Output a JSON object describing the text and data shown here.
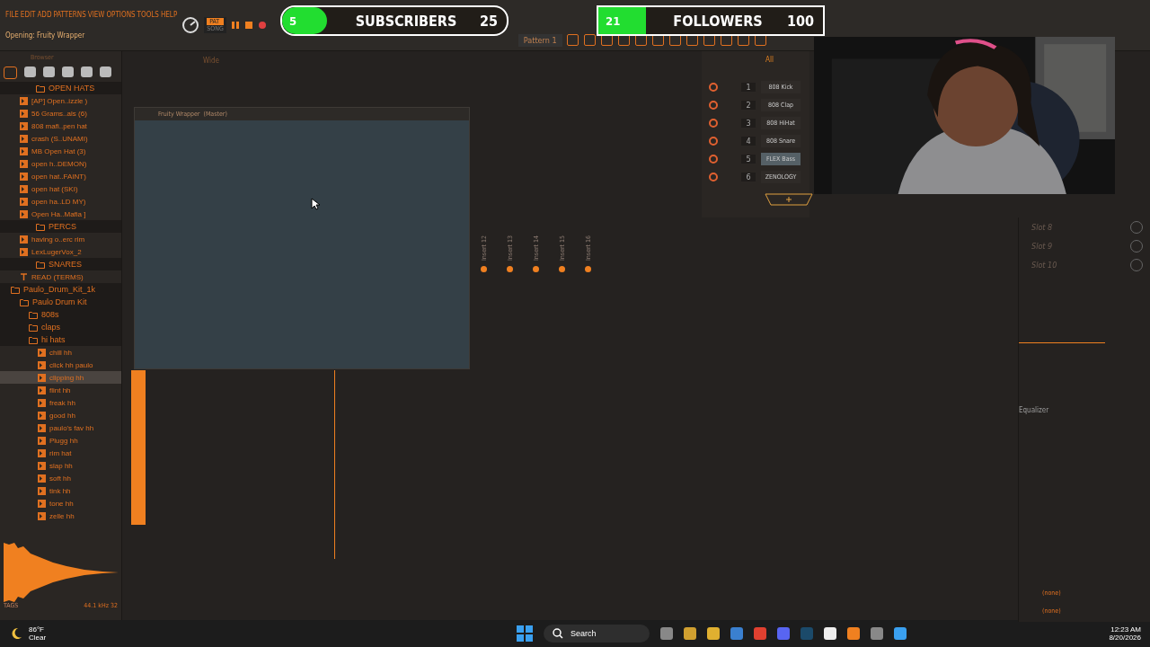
{
  "menu": [
    "FILE",
    "EDIT",
    "ADD",
    "PATTERNS",
    "VIEW",
    "OPTIONS",
    "TOOLS",
    "HELP"
  ],
  "hint": "Opening: Fruity Wrapper",
  "transport": {
    "mode": "PAT",
    "alt_mode": "SONG",
    "pattern": "Pattern 1"
  },
  "counters": [
    {
      "current": "5",
      "label": "SUBSCRIBERS",
      "goal": "25",
      "level": 0.2,
      "kind": "pill"
    },
    {
      "current": "21",
      "label": "FOLLOWERS",
      "goal": "100",
      "level": 0.21,
      "kind": "box"
    }
  ],
  "browser": {
    "title": "Browser",
    "tree": [
      {
        "label": "OPEN HATS",
        "kind": "folder",
        "selected": false,
        "children": [
          {
            "label": "[AP] Open..izzle )",
            "kind": "file",
            "selected": false
          },
          {
            "label": "56 Grams..als (6)",
            "kind": "file",
            "selected": false
          },
          {
            "label": "808 mafi..pen hat",
            "kind": "file",
            "selected": false
          },
          {
            "label": "crash (S..UNAMI)",
            "kind": "file",
            "selected": false
          },
          {
            "label": "MB Open Hat (3)",
            "kind": "file",
            "selected": false
          },
          {
            "label": "open h..DEMON)",
            "kind": "file",
            "selected": false
          },
          {
            "label": "open hat..FAINT)",
            "kind": "file",
            "selected": false
          },
          {
            "label": "open hat (SKI)",
            "kind": "file",
            "selected": false
          },
          {
            "label": "open ha..LD MY)",
            "kind": "file",
            "selected": false
          },
          {
            "label": "Open Ha..Mafia ]",
            "kind": "file",
            "selected": false
          }
        ]
      },
      {
        "label": "PERCS",
        "kind": "folder",
        "selected": false,
        "children": [
          {
            "label": "having o..erc rim",
            "kind": "file",
            "selected": false
          },
          {
            "label": "LexLugerVox_2",
            "kind": "file",
            "selected": false
          }
        ]
      },
      {
        "label": "SNARES",
        "kind": "folder",
        "selected": false,
        "children": [
          {
            "label": "READ (TERMS)",
            "kind": "text",
            "selected": false
          }
        ]
      },
      {
        "label": "Paulo_Drum_Kit_1k",
        "kind": "folder",
        "selected": false,
        "children": [
          {
            "label": "Paulo Drum Kit",
            "kind": "folder",
            "selected": false,
            "children": [
              {
                "label": "808s",
                "kind": "folder",
                "selected": false
              },
              {
                "label": "claps",
                "kind": "folder",
                "selected": false
              },
              {
                "label": "hi hats",
                "kind": "folder",
                "selected": false,
                "children": [
                  {
                    "label": "chill hh",
                    "kind": "file",
                    "selected": false
                  },
                  {
                    "label": "click hh paulo",
                    "kind": "file",
                    "selected": false
                  },
                  {
                    "label": "clipping hh",
                    "kind": "file",
                    "selected": true
                  },
                  {
                    "label": "flint hh",
                    "kind": "file",
                    "selected": false
                  },
                  {
                    "label": "freak hh",
                    "kind": "file",
                    "selected": false
                  },
                  {
                    "label": "good hh",
                    "kind": "file",
                    "selected": false
                  },
                  {
                    "label": "paulo's fav hh",
                    "kind": "file",
                    "selected": false
                  },
                  {
                    "label": "Plugg hh",
                    "kind": "file",
                    "selected": false
                  },
                  {
                    "label": "rim hat",
                    "kind": "file",
                    "selected": false
                  },
                  {
                    "label": "slap hh",
                    "kind": "file",
                    "selected": false
                  },
                  {
                    "label": "soft hh",
                    "kind": "file",
                    "selected": false
                  },
                  {
                    "label": "tink hh",
                    "kind": "file",
                    "selected": false
                  },
                  {
                    "label": "tone hh",
                    "kind": "file",
                    "selected": false
                  },
                  {
                    "label": "zelle hh",
                    "kind": "file",
                    "selected": false
                  }
                ]
              }
            ]
          }
        ]
      }
    ],
    "sample_info": "44.1 kHz 32",
    "tags": "TAGS"
  },
  "playlist_toolbar": "Wide",
  "wrapper": {
    "title": "Fruity Wrapper",
    "subtitle": "(Master)"
  },
  "mixer_inserts": [
    "Insert 12",
    "Insert 13",
    "Insert 14",
    "Insert 15",
    "Insert 16"
  ],
  "channel_rack": {
    "filter": "All",
    "channels": [
      {
        "number": "1",
        "name": "808 Kick",
        "selected": false
      },
      {
        "number": "2",
        "name": "808 Clap",
        "selected": false
      },
      {
        "number": "3",
        "name": "808 HiHat",
        "selected": false
      },
      {
        "number": "4",
        "name": "808 Snare",
        "selected": false
      },
      {
        "number": "5",
        "name": "FLEX Bass",
        "selected": true
      },
      {
        "number": "6",
        "name": "ZENOLOGY",
        "selected": false
      }
    ]
  },
  "webcam": {
    "kind": "picture"
  },
  "mixer_slots": [
    "Slot 8",
    "Slot 9",
    "Slot 10"
  ],
  "equalizer": "Equalizer",
  "routes": [
    "(none)",
    "(none)"
  ],
  "taskbar": {
    "temperature": "86°F",
    "weather": "Clear",
    "search": "Search",
    "time": "12:23 AM",
    "date": "8/20/2026"
  }
}
